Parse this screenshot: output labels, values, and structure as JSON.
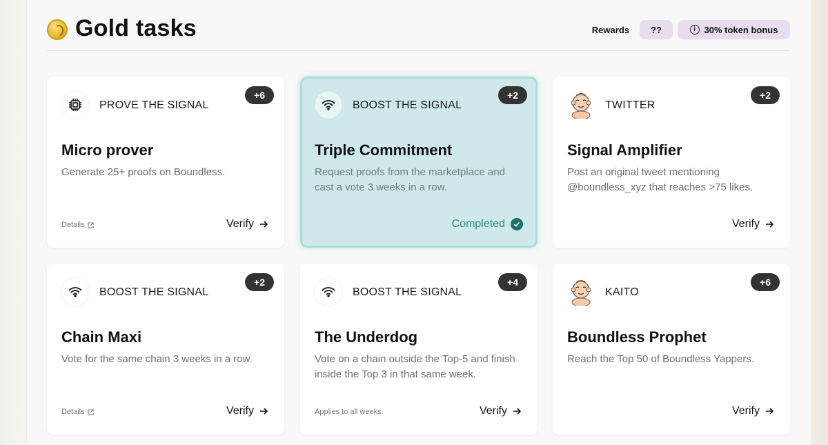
{
  "header": {
    "title": "Gold tasks",
    "rewards_label": "Rewards",
    "rewards_value": "??",
    "bonus_label": "30% token bonus"
  },
  "cards": [
    {
      "category": "PROVE THE SIGNAL",
      "icon": "chip-icon",
      "points": "+6",
      "name": "Micro prover",
      "description": "Generate 25+ proofs on Boundless.",
      "details": "Details",
      "action": "Verify"
    },
    {
      "category": "BOOST THE SIGNAL",
      "icon": "signal-icon",
      "points": "+2",
      "name": "Triple Commitment",
      "description": "Request proofs from the marketplace and cast a vote 3 weeks in a row.",
      "status": "Completed"
    },
    {
      "category": "TWITTER",
      "icon": "avatar-icon",
      "points": "+2",
      "name": "Signal Amplifier",
      "description": "Post an original tweet mentioning @boundless_xyz that reaches >75 likes.",
      "action": "Verify"
    },
    {
      "category": "BOOST THE SIGNAL",
      "icon": "signal-icon",
      "points": "+2",
      "name": "Chain Maxi",
      "description": "Vote for the same chain 3 weeks in a row.",
      "details": "Details",
      "action": "Verify"
    },
    {
      "category": "BOOST THE SIGNAL",
      "icon": "signal-icon",
      "points": "+4",
      "name": "The Underdog",
      "description": "Vote on a chain outside the Top-5 and finish inside the Top 3 in that same week.",
      "note": "Applies to all weeks.",
      "action": "Verify"
    },
    {
      "category": "KAITO",
      "icon": "avatar-icon",
      "points": "+6",
      "name": "Boundless Prophet",
      "description": "Reach the Top 50 of Boundless Yappers.",
      "action": "Verify"
    }
  ],
  "colors": {
    "badge_bg": "#333333",
    "pill_bg": "#e9dcef",
    "completed_bg": "#cfe9ea",
    "completed_text": "#2a8a84"
  }
}
